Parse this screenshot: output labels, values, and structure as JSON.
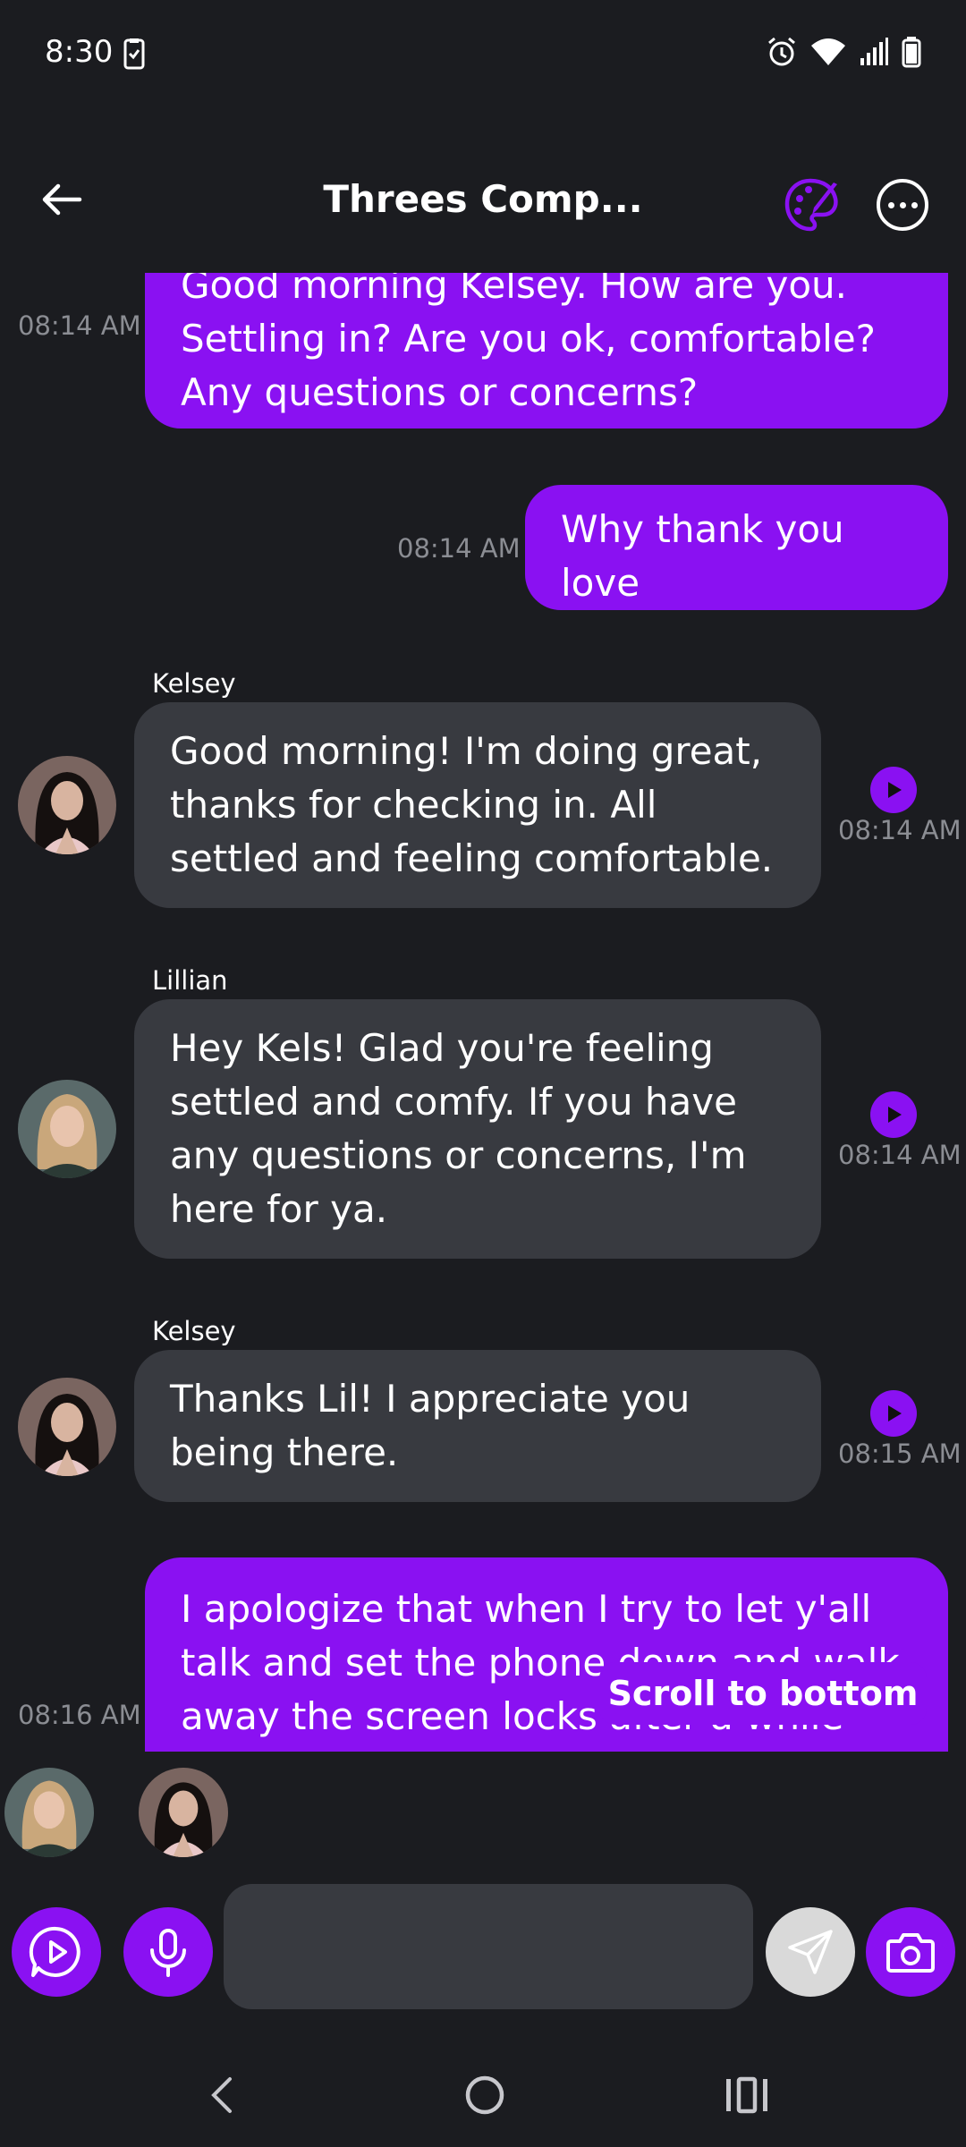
{
  "status_bar": {
    "time": "8:30"
  },
  "header": {
    "title": "Threes Comp..."
  },
  "messages": [
    {
      "text": "Good morning Kelsey. How are you. Settling in? Are you ok, comfortable? Any questions or concerns?",
      "time": "08:14 AM"
    },
    {
      "text": "Why thank you love",
      "time": "08:14 AM"
    },
    {
      "sender": "Kelsey",
      "text": "Good morning! I'm doing great, thanks for checking in. All settled and feeling comfortable.",
      "time": "08:14 AM"
    },
    {
      "sender": "Lillian",
      "text": "Hey Kels! Glad you're feeling settled and comfy. If you have any questions or concerns, I'm here for ya.",
      "time": "08:14 AM"
    },
    {
      "sender": "Kelsey",
      "text": "Thanks Lil! I appreciate you being there.",
      "time": "08:15 AM"
    },
    {
      "text": "I apologize that when I try to let y'all talk and set the phone down and walk away the screen locks after a while and the app kills the conversation so far",
      "time": "08:16 AM"
    }
  ],
  "scroll_to_bottom_label": "Scroll to bottom",
  "composer": {
    "value": "",
    "placeholder": ""
  },
  "colors": {
    "accent": "#8a11f2",
    "background": "#1b1c20",
    "bubble_gray": "#383a40",
    "timestamp": "#8b8d93"
  },
  "icons": [
    "back-arrow-icon",
    "palette-icon",
    "more-icon",
    "play-icon",
    "mic-icon",
    "send-icon",
    "camera-icon"
  ]
}
